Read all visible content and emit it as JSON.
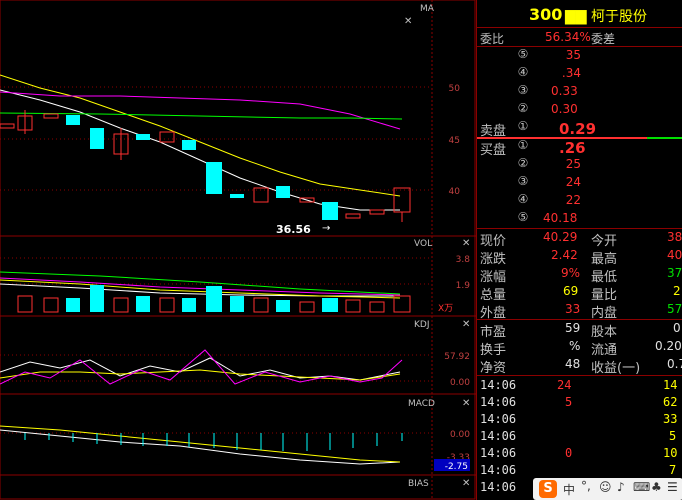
{
  "chart": {
    "ma_label": "MA",
    "price_axis": [
      "50",
      "45",
      "40"
    ],
    "price_annotation": "36.56",
    "vol_label": "VOL",
    "vol_axis": [
      "3.8",
      "1.9"
    ],
    "vol_unit": "X万",
    "kdj_label": "KDJ",
    "kdj_axis": [
      "57.92",
      "0.00"
    ],
    "macd_label": "MACD",
    "macd_axis": [
      "0.00",
      "-3.33"
    ],
    "macd_value": "-2.75",
    "bias_label": "BIAS"
  },
  "quote": {
    "code": "300",
    "name_masked": "▇▇ 柯于股份",
    "ratio_label": "委比",
    "ratio_value": "56.34%",
    "diff_label": "委差",
    "sell_label": "卖盘",
    "buy_label": "买盘",
    "asks": [
      {
        "idx": "⑤",
        "price": "35"
      },
      {
        "idx": "④",
        "price": ".34"
      },
      {
        "idx": "③",
        "price": "0.33"
      },
      {
        "idx": "②",
        "price": "0.30"
      },
      {
        "idx": "①",
        "price": "0.29"
      }
    ],
    "bids": [
      {
        "idx": "①",
        "price": ".26"
      },
      {
        "idx": "②",
        "price": "25"
      },
      {
        "idx": "③",
        "price": "24"
      },
      {
        "idx": "④",
        "price": "22"
      },
      {
        "idx": "⑤",
        "price": "40.18"
      }
    ],
    "stats": [
      {
        "l1": "现价",
        "v1": "40.29",
        "l2": "今开",
        "v2": "38"
      },
      {
        "l1": "涨跌",
        "v1": "2.42",
        "l2": "最高",
        "v2": "40"
      },
      {
        "l1": "涨幅",
        "v1": "9%",
        "l2": "最低",
        "v2": "37"
      },
      {
        "l1": "总量",
        "v1": "69",
        "l2": "量比",
        "v2": "2"
      },
      {
        "l1": "外盘",
        "v1": "33",
        "l2": "内盘",
        "v2": "57"
      }
    ],
    "fund": [
      {
        "l1": "市盈",
        "v1": "59",
        "l2": "股本",
        "v2": "0"
      },
      {
        "l1": "换手",
        "v1": "%",
        "l2": "流通",
        "v2": "0.20"
      },
      {
        "l1": "净资",
        "v1": "48",
        "l2": "收益(一)",
        "v2": "0.7"
      }
    ],
    "ticks": [
      {
        "time": "14:06",
        "price": "24",
        "vol": "14"
      },
      {
        "time": "14:06",
        "price": "5",
        "vol": "62"
      },
      {
        "time": "14:06",
        "price": "",
        "vol": "33"
      },
      {
        "time": "14:06",
        "price": "",
        "vol": "5"
      },
      {
        "time": "14:06",
        "price": "0",
        "vol": "10"
      },
      {
        "time": "14:06",
        "price": "",
        "vol": "7"
      },
      {
        "time": "14:06",
        "price": "",
        "vol": ""
      }
    ]
  },
  "colors": {
    "up": "#ff3030",
    "down": "#00ffff",
    "ma5": "#ffffff",
    "ma10": "#ffff00",
    "ma20": "#ff00ff",
    "ma60": "#00ff00"
  }
}
